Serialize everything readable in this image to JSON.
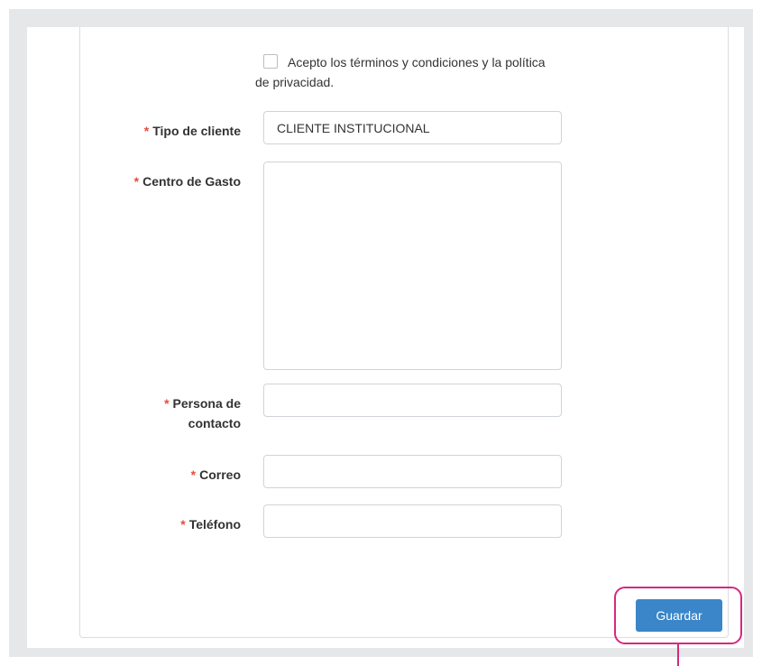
{
  "form": {
    "terms_text": "Acepto los términos y condiciones y la política de privacidad.",
    "required_mark": "*",
    "fields": {
      "tipo_cliente": {
        "label": "Tipo de cliente",
        "value": "CLIENTE INSTITUCIONAL"
      },
      "centro_gasto": {
        "label": "Centro de Gasto",
        "value": ""
      },
      "persona_contacto": {
        "label_line1": "Persona de",
        "label_line2": "contacto",
        "value": ""
      },
      "correo": {
        "label": "Correo",
        "value": ""
      },
      "telefono": {
        "label": "Teléfono",
        "value": ""
      }
    },
    "save_label": "Guardar"
  },
  "colors": {
    "required": "#e74c3c",
    "primary_button": "#3a86c8",
    "highlight": "#d6287f",
    "background": "#e6e7e8"
  }
}
